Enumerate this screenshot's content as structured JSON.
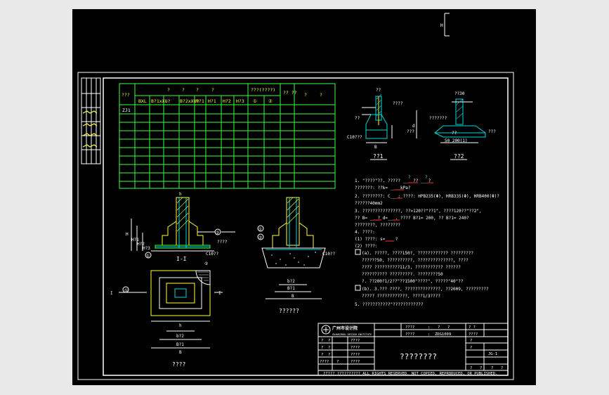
{
  "scale_mark": "H",
  "title_block_legend": {
    "lines": [
      "?????",
      "?????",
      "?????",
      "?????",
      "?????"
    ]
  },
  "schedule_table": {
    "header_row1": [
      "???",
      "?",
      "?",
      "?",
      "?",
      "???(????)",
      "??\n??",
      "?",
      "?"
    ],
    "header_row2": [
      "BXL",
      "B?1xXU?",
      "B?2xXU?",
      "h?1",
      "H?1",
      "H?2",
      "H?3",
      "①",
      "②"
    ],
    "first_row_label": "ZJ1"
  },
  "detail_1": {
    "caption": "??1",
    "labels": [
      "??",
      "????",
      "C10???",
      "B",
      "d",
      "???",
      "??"
    ]
  },
  "detail_2": {
    "caption": "??2",
    "labels": [
      "??30",
      "???????",
      "??",
      "???",
      "50  200(1)"
    ]
  },
  "notes": [
    "1. \"????\"??. ????? ____?? ___?",
    "   ???????: ??k= ____kPa?",
    "2. ????????: C___; ????: HPB235(Φ), HRB335(Φ), HRB400(Φ)?",
    "   ??????40mm2",
    "3. ???????????????, ??>120??\"??1\", ????120??\"??2\",",
    "   ?? B= ___? d=___. ???? B?1= 200, ?? B?1= 240?",
    "   ????????, ????????",
    "4. ????:",
    "   (1) ????: s=___ ?",
    "   (2) ????:",
    "(a). ?????, ????150?, ???????????? ?????????",
    "   ??????50, ??????????, ??????????????, ????",
    "   ???? ??????????11/3, ??????????? ??????",
    "   ?????????? ?????????. ????????50",
    "   ?. ??200?1/2??\"??1500\"????\", ?????\"40\"??",
    "(b). 3.??? ????, ??????????????, ??2009, ?????????",
    "   ????? ????????????, ????1/3????",
    "5. ???????????\"????????????"
  ],
  "plan_view": {
    "caption": "????",
    "labels": [
      "I",
      "I",
      "h",
      "b?2",
      "B?1",
      "B",
      "②",
      "①"
    ]
  },
  "section_1": {
    "caption": "I-I",
    "labels": [
      "h",
      "C10??",
      "②",
      "①",
      "H",
      "H?1",
      "H?2",
      "H?3",
      "????"
    ]
  },
  "section_2": {
    "caption": "??????",
    "labels": [
      "①",
      "②",
      "C10??",
      "b?2",
      "B?1",
      "B"
    ]
  },
  "title_block": {
    "institute_cn": "广州市设计院",
    "institute_en": "GUANGZHOU DESIGN INSTITUTE",
    "drawing_title": "????????",
    "row1": [
      "????",
      ":",
      "?",
      "?",
      "? ?"
    ],
    "row2": [
      "????",
      ":",
      "ZDG1009",
      "????"
    ],
    "rows_left": [
      [
        "?",
        "?",
        "?",
        "????"
      ],
      [
        "?",
        "?",
        "????"
      ],
      [
        "?",
        "?",
        "????"
      ],
      [
        "????",
        "?",
        "????"
      ]
    ],
    "right_cells": [
      "?",
      "?",
      "JG-1",
      "?",
      "?",
      "?",
      "?"
    ],
    "copyright": "????? ?????????? ALL RIGHTS RESERVED. NOT COPIED, REPRODUCED, OR PUBLISHED."
  }
}
